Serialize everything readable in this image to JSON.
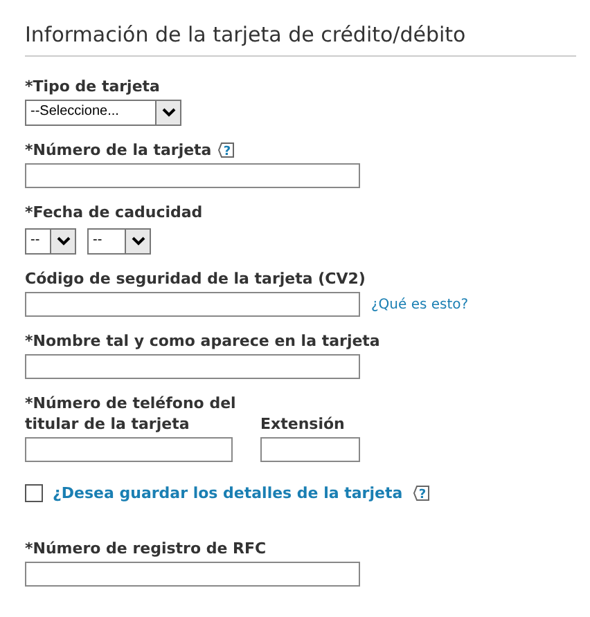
{
  "heading": "Información de la tarjeta de crédito/débito",
  "fields": [
    {
      "kind": "select",
      "label": "*Tipo de tarjeta",
      "value": "--Seleccione..."
    },
    {
      "kind": "text",
      "label": "*Número de la tarjeta",
      "help": "?"
    },
    {
      "kind": "date",
      "label": "*Fecha de caducidad",
      "month": "--",
      "year": "--"
    },
    {
      "kind": "text",
      "label": "Código de seguridad de la tarjeta (CV2)",
      "link": "¿Qué es esto?"
    },
    {
      "kind": "text",
      "label": "*Nombre tal y como aparece en la tarjeta"
    },
    {
      "kind": "phone",
      "label": "*Número de teléfono del titular de la tarjeta",
      "extension_label": "Extensión"
    },
    {
      "kind": "checkbox",
      "label": "¿Desea guardar los detalles de la tarjeta",
      "checked": false,
      "help": "?"
    },
    {
      "kind": "text",
      "label": "*Número de registro de RFC"
    }
  ]
}
